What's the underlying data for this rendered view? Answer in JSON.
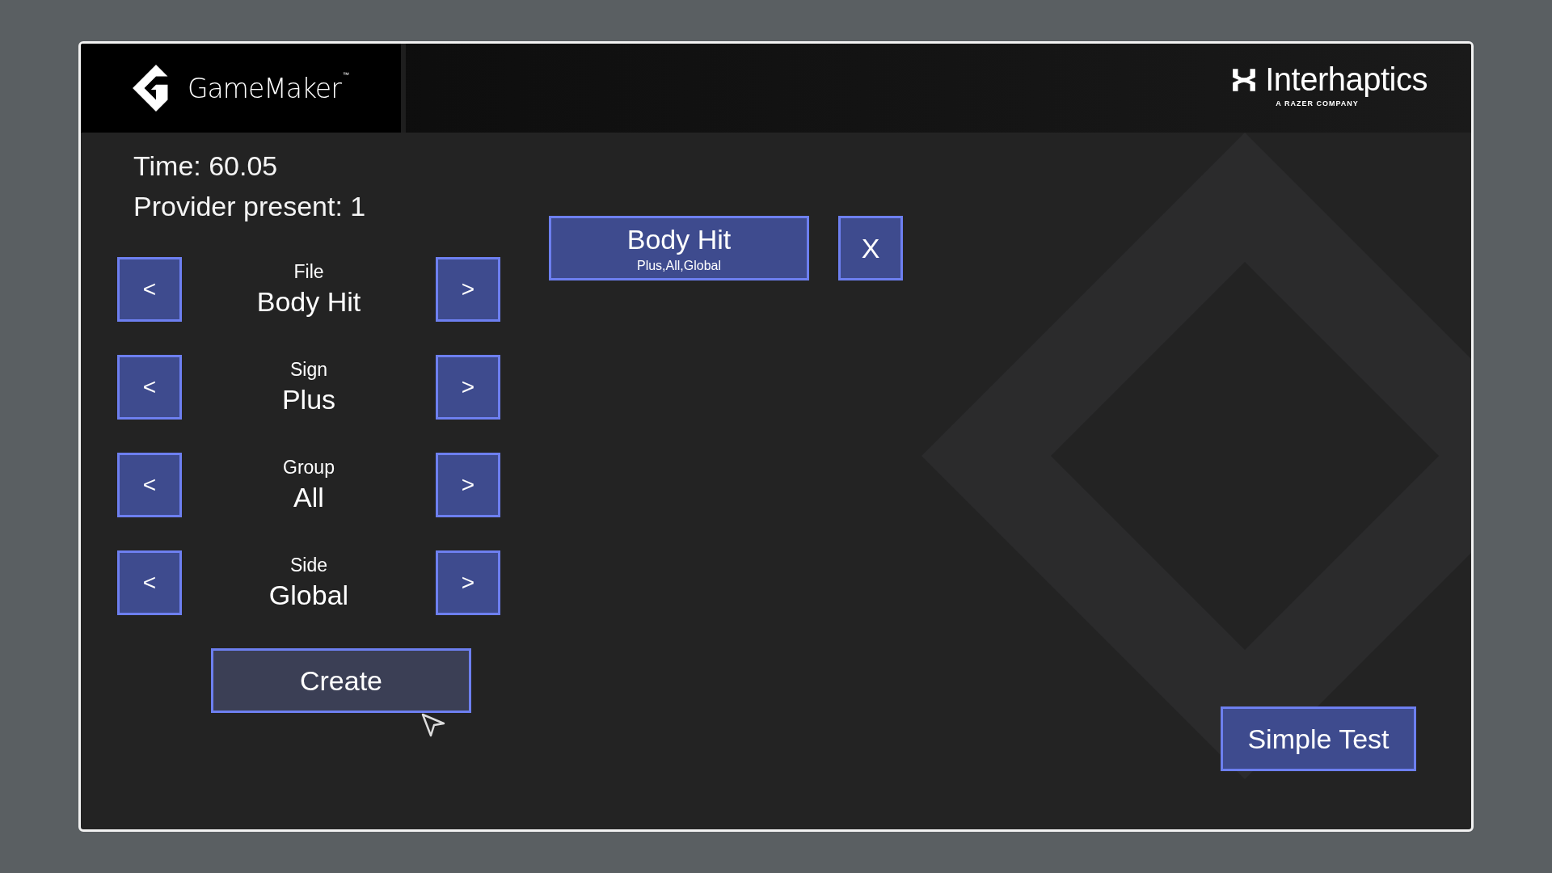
{
  "header": {
    "left_logo": {
      "name": "GameMaker",
      "mark": "™"
    },
    "right_logo": {
      "name": "Interhaptics",
      "tagline": "A RAZER COMPANY"
    }
  },
  "status": [
    {
      "text": "Time: 60.05"
    },
    {
      "text": "Provider present: 1"
    }
  ],
  "selectors": [
    {
      "label": "File",
      "value": "Body Hit",
      "prev": "<",
      "next": ">"
    },
    {
      "label": "Sign",
      "value": "Plus",
      "prev": "<",
      "next": ">"
    },
    {
      "label": "Group",
      "value": "All",
      "prev": "<",
      "next": ">"
    },
    {
      "label": "Side",
      "value": "Global",
      "prev": "<",
      "next": ">"
    }
  ],
  "create_button": {
    "label": "Create",
    "hovered": true
  },
  "effects": [
    {
      "title": "Body Hit",
      "subtitle": "Plus,All,Global",
      "remove": "X"
    }
  ],
  "simple_test_button": {
    "label": "Simple Test",
    "hovered": false
  }
}
